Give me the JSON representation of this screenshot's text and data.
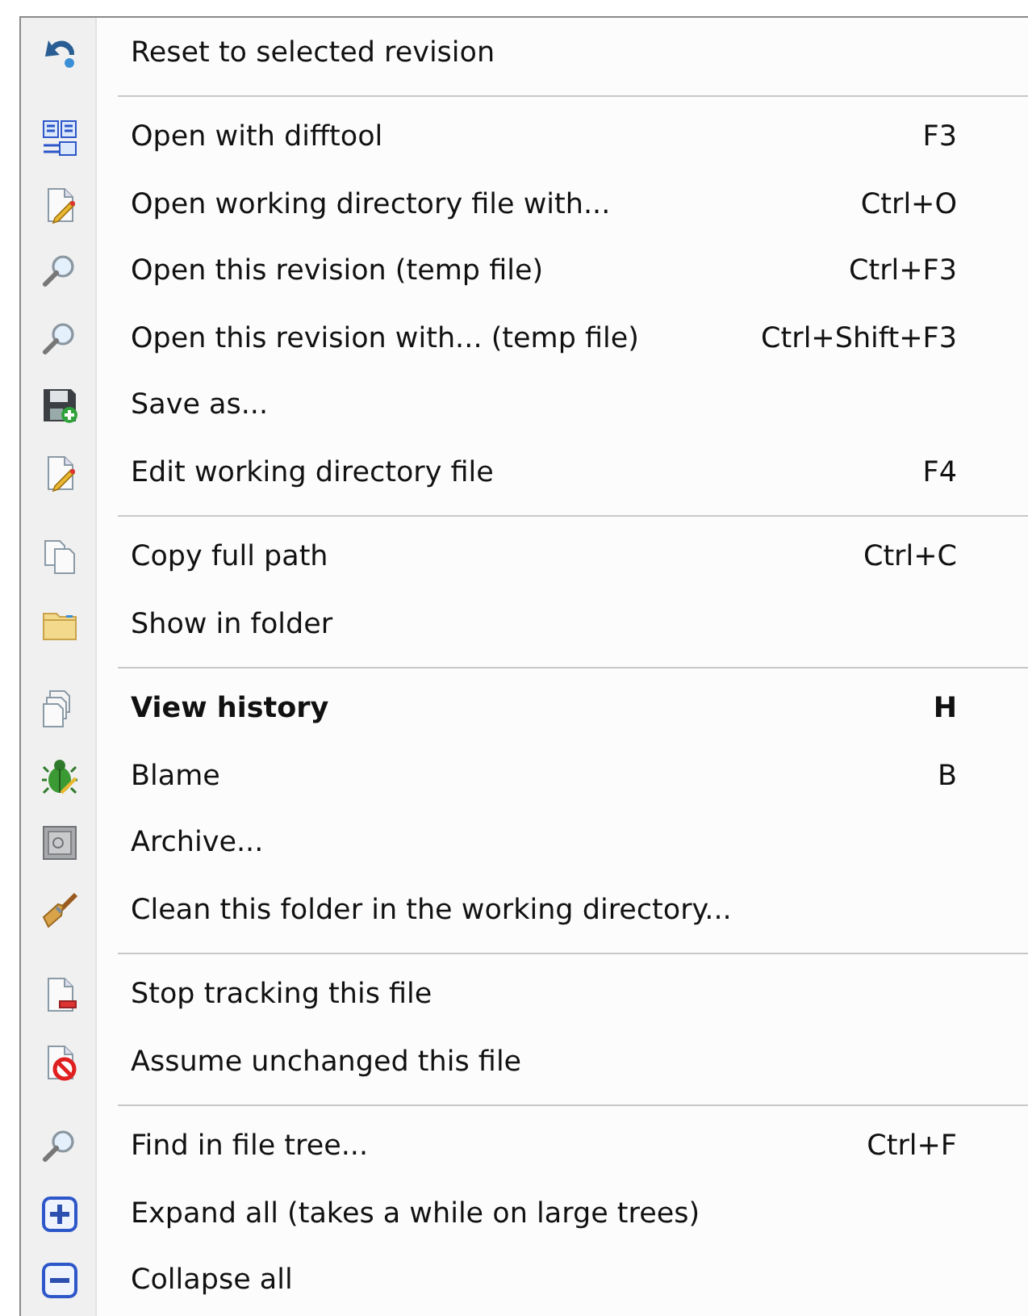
{
  "menu": {
    "groups": [
      [
        {
          "label": "Reset to selected revision",
          "bold": false
        }
      ],
      [
        {
          "label": "Open with difftool",
          "shortcut": "F3",
          "bold": false
        },
        {
          "label": "Open working directory file with...",
          "shortcut": "Ctrl+O",
          "bold": false
        },
        {
          "label": "Open this revision (temp file)",
          "shortcut": "Ctrl+F3",
          "bold": false
        },
        {
          "label": "Open this revision with... (temp file)",
          "shortcut": "Ctrl+Shift+F3",
          "bold": false
        },
        {
          "label": "Save as...",
          "bold": false
        },
        {
          "label": "Edit working directory file",
          "shortcut": "F4",
          "bold": false
        }
      ],
      [
        {
          "label": "Copy full path",
          "shortcut": "Ctrl+C",
          "bold": false
        },
        {
          "label": "Show in folder",
          "bold": false
        }
      ],
      [
        {
          "label": "View history",
          "shortcut": "H",
          "bold": true
        },
        {
          "label": "Blame",
          "shortcut": "B",
          "bold": false
        },
        {
          "label": "Archive...",
          "bold": false
        },
        {
          "label": "Clean this folder in the working directory...",
          "bold": false
        }
      ],
      [
        {
          "label": "Stop tracking this file",
          "bold": false
        },
        {
          "label": "Assume unchanged this file",
          "bold": false
        }
      ],
      [
        {
          "label": "Find in file tree...",
          "shortcut": "Ctrl+F",
          "bold": false
        },
        {
          "label": "Expand all (takes a while on large trees)",
          "bold": false
        },
        {
          "label": "Collapse all",
          "bold": false
        }
      ]
    ]
  }
}
